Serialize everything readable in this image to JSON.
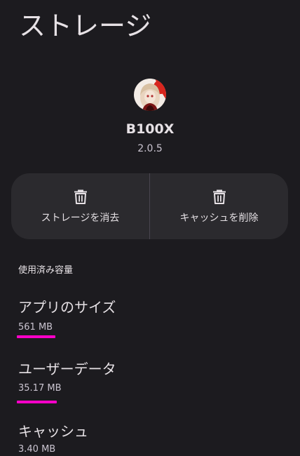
{
  "page": {
    "title": "ストレージ"
  },
  "app": {
    "name": "B100X",
    "version": "2.0.5",
    "icon": "app-avatar-icon"
  },
  "actions": {
    "clear_storage": {
      "label": "ストレージを消去",
      "icon": "trash-icon"
    },
    "clear_cache": {
      "label": "キャッシュを削除",
      "icon": "trash-icon"
    }
  },
  "usage": {
    "header": "使用済み容量",
    "items": [
      {
        "title": "アプリのサイズ",
        "value": "561 MB"
      },
      {
        "title": "ユーザーデータ",
        "value": "35.17 MB"
      },
      {
        "title": "キャッシュ",
        "value": "3.40 MB"
      }
    ]
  },
  "colors": {
    "background": "#1c1b1f",
    "surface": "#2b2a2e",
    "highlight": "#ff00c8"
  }
}
